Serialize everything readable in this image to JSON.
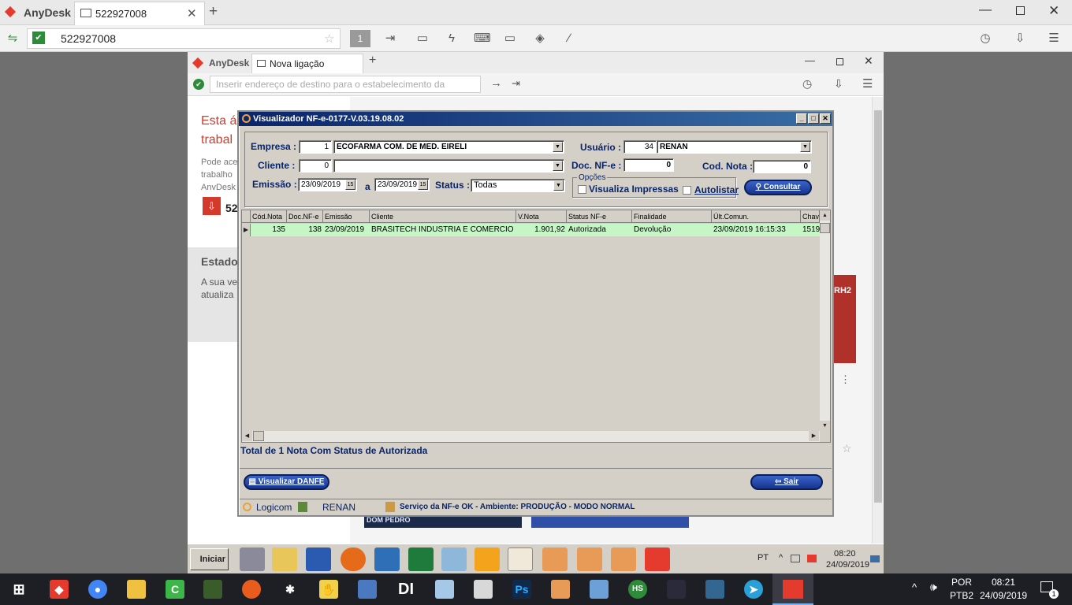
{
  "outer": {
    "app": "AnyDesk",
    "tab": "522927008",
    "address": "522927008",
    "session_badge": "1"
  },
  "inner": {
    "app": "AnyDesk",
    "tab": "Nova ligação",
    "address_placeholder": "Inserir endereço de destino para o estabelecimento da"
  },
  "bg_page": {
    "heading1": "Esta á",
    "heading2": "trabal",
    "para1": "Pode ace",
    "para2": "trabalho",
    "para3": "AnvDesk",
    "addr_partial": "52",
    "estado": "Estado",
    "status1": "A sua ve",
    "status2": "atualiza",
    "side_label": "RH2",
    "card_label": "DOM PEDRO"
  },
  "viewer": {
    "title": "Visualizador NF-e-0177-V.03.19.08.02",
    "empresa_label": "Empresa :",
    "empresa_code": "1",
    "empresa_name": "ECOFARMA COM. DE MED. EIRELI",
    "usuario_label": "Usuário :",
    "usuario_code": "34",
    "usuario_name": "RENAN",
    "cliente_label": "Cliente :",
    "cliente_code": "0",
    "cliente_name": "",
    "docnfe_label": "Doc. NF-e :",
    "docnfe_value": "0",
    "codnota_label": "Cod. Nota :",
    "codnota_value": "0",
    "emissao_label": "Emissão :",
    "emissao_from": "23/09/2019",
    "emissao_a": "a",
    "emissao_to": "23/09/2019",
    "status_label": "Status :",
    "status_value": "Todas",
    "opcoes_label": "Opções",
    "visualiza_label": "Visualiza Impressas",
    "autolistar_label": "Autolistar",
    "consultar_label": "Consultar",
    "columns": [
      "Cód.Nota",
      "Doc.NF-e",
      "Emissão",
      "Cliente",
      "V.Nota",
      "Status NF-e",
      "Finalidade",
      "Últ.Comun.",
      "Chav"
    ],
    "row": {
      "cod": "135",
      "doc": "138",
      "emissao": "23/09/2019",
      "cliente": "BRASITECH INDUSTRIA E COMERCIO",
      "valor": "1.901,92",
      "status": "Autorizada",
      "finalidade": "Devolução",
      "ultcomun": "23/09/2019 16:15:33",
      "chave": "1519"
    },
    "total_text": "Total de 1 Nota Com Status de Autorizada",
    "danfe_label": "Visualizar DANFE",
    "sair_label": "Sair",
    "status_app": "Logicom",
    "status_user": "RENAN",
    "status_msg": "Serviço da NF-e OK - Ambiente: PRODUÇÃO - MODO NORMAL"
  },
  "remote_taskbar": {
    "start": "Iniciar",
    "lang": "PT",
    "time": "08:20",
    "date": "24/09/2019"
  },
  "win_taskbar": {
    "lang1": "POR",
    "lang2": "PTB2",
    "time": "08:21",
    "date": "24/09/2019",
    "notif": "1"
  }
}
